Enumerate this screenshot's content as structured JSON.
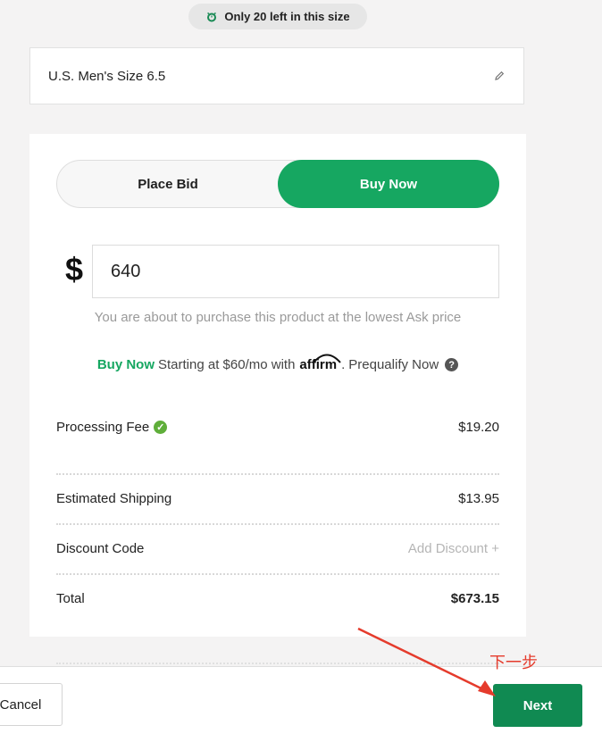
{
  "stock_badge": {
    "icon": "clock-icon",
    "text": "Only 20 left in this size"
  },
  "size_selector": {
    "label": "U.S. Men's Size 6.5",
    "edit_icon": "pencil-icon"
  },
  "toggle": {
    "place_bid_label": "Place Bid",
    "buy_now_label": "Buy Now",
    "active": "Buy Now",
    "active_color": "#16a761"
  },
  "price": {
    "currency_symbol": "$",
    "value": "640"
  },
  "lowest_ask_note": "You are about to purchase this product at the lowest Ask price",
  "affirm": {
    "buy_now": "Buy Now",
    "starting_text": "Starting at $60/mo with",
    "logo": "affirm",
    "suffix": ".",
    "prequalify": "Prequalify Now",
    "help_icon": "question-icon"
  },
  "fees": {
    "processing_fee_label": "Processing Fee",
    "processing_fee_icon": "check-icon",
    "processing_fee_value": "$19.20",
    "shipping_label": "Estimated Shipping",
    "shipping_value": "$13.95",
    "discount_label": "Discount Code",
    "discount_action": "Add Discount +",
    "total_label": "Total",
    "total_value": "$673.15"
  },
  "footer": {
    "cancel_label": "Cancel",
    "next_label": "Next",
    "next_color": "#108a52"
  },
  "annotation": {
    "label": "下一步",
    "color": "#e53b2c"
  }
}
